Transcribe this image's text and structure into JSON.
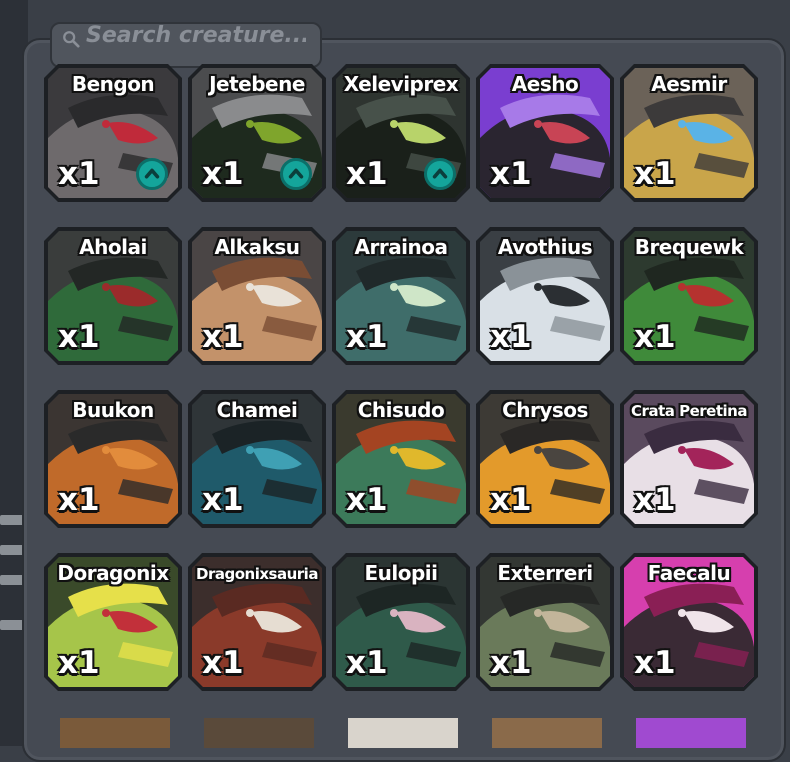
{
  "search": {
    "placeholder": "Search creature..."
  },
  "cards": [
    {
      "name": "Bengon",
      "qty": "x1",
      "upgrade": true,
      "colors": [
        "#3b3a3d",
        "#6e6a6c",
        "#c02a3a",
        "#2a2a2c"
      ]
    },
    {
      "name": "Jetebene",
      "qty": "x1",
      "upgrade": true,
      "colors": [
        "#4b4c4e",
        "#1e2a1e",
        "#7fa52c",
        "#8a8b8d"
      ]
    },
    {
      "name": "Xeleviprex",
      "qty": "x1",
      "upgrade": true,
      "colors": [
        "#2e3430",
        "#1a201a",
        "#b8d36a",
        "#47514a"
      ]
    },
    {
      "name": "Aesho",
      "qty": "x1",
      "upgrade": false,
      "colors": [
        "#7a3ed0",
        "#2a2530",
        "#c84455",
        "#a77ae8"
      ]
    },
    {
      "name": "Aesmir",
      "qty": "x1",
      "upgrade": false,
      "colors": [
        "#6b6258",
        "#c9a54a",
        "#5ab3e6",
        "#3c3a3a"
      ]
    },
    {
      "name": "Aholai",
      "qty": "x1",
      "upgrade": false,
      "colors": [
        "#3a3d3c",
        "#2f6a3a",
        "#9b2b2b",
        "#232725"
      ]
    },
    {
      "name": "Alkaksu",
      "qty": "x1",
      "upgrade": false,
      "colors": [
        "#4a4545",
        "#c3926a",
        "#e9e2d8",
        "#7a4d34"
      ]
    },
    {
      "name": "Arrainoa",
      "qty": "x1",
      "upgrade": false,
      "colors": [
        "#2c3a3b",
        "#3f6d6a",
        "#cfe6c8",
        "#20292a"
      ]
    },
    {
      "name": "Avothius",
      "qty": "x1",
      "upgrade": false,
      "colors": [
        "#3a3f44",
        "#d9e0e6",
        "#2b2f33",
        "#8a9298"
      ]
    },
    {
      "name": "Brequewk",
      "qty": "x1",
      "upgrade": false,
      "colors": [
        "#2d3a2f",
        "#3f8a3a",
        "#b5322f",
        "#1f2720"
      ]
    },
    {
      "name": "Buukon",
      "qty": "x1",
      "upgrade": false,
      "colors": [
        "#3b3532",
        "#c06a2a",
        "#e28c3c",
        "#2a2a2a"
      ]
    },
    {
      "name": "Chamei",
      "qty": "x1",
      "upgrade": false,
      "colors": [
        "#2f3538",
        "#1f5a6a",
        "#3fa0b4",
        "#1b2326"
      ]
    },
    {
      "name": "Chisudo",
      "qty": "x1",
      "upgrade": false,
      "colors": [
        "#3a3a2e",
        "#3c7a5a",
        "#e0b82c",
        "#a44422"
      ]
    },
    {
      "name": "Chrysos",
      "qty": "x1",
      "upgrade": false,
      "colors": [
        "#3d3a35",
        "#e39a2b",
        "#4a4540",
        "#2a2826"
      ]
    },
    {
      "name": "Crata Peretina",
      "qty": "x1",
      "upgrade": false,
      "colors": [
        "#5a4a5e",
        "#e8dfe6",
        "#a3245a",
        "#3a2c40"
      ]
    },
    {
      "name": "Doragonix",
      "qty": "x1",
      "upgrade": false,
      "colors": [
        "#3a4a2a",
        "#a6c54a",
        "#c2303a",
        "#e6e04a"
      ]
    },
    {
      "name": "Dragonixsauria",
      "qty": "x1",
      "upgrade": false,
      "colors": [
        "#3c2e2c",
        "#8a3a2a",
        "#e6ddd2",
        "#5a2a22"
      ]
    },
    {
      "name": "Eulopii",
      "qty": "x1",
      "upgrade": false,
      "colors": [
        "#2b3533",
        "#2f5a4a",
        "#d9b3c0",
        "#1d2624"
      ]
    },
    {
      "name": "Exterreri",
      "qty": "x1",
      "upgrade": false,
      "colors": [
        "#333733",
        "#6a7a5a",
        "#c2b59a",
        "#262826"
      ]
    },
    {
      "name": "Faecalu",
      "qty": "x1",
      "upgrade": false,
      "colors": [
        "#d63fae",
        "#3a2a35",
        "#f0e4ea",
        "#8a1f55"
      ]
    }
  ]
}
